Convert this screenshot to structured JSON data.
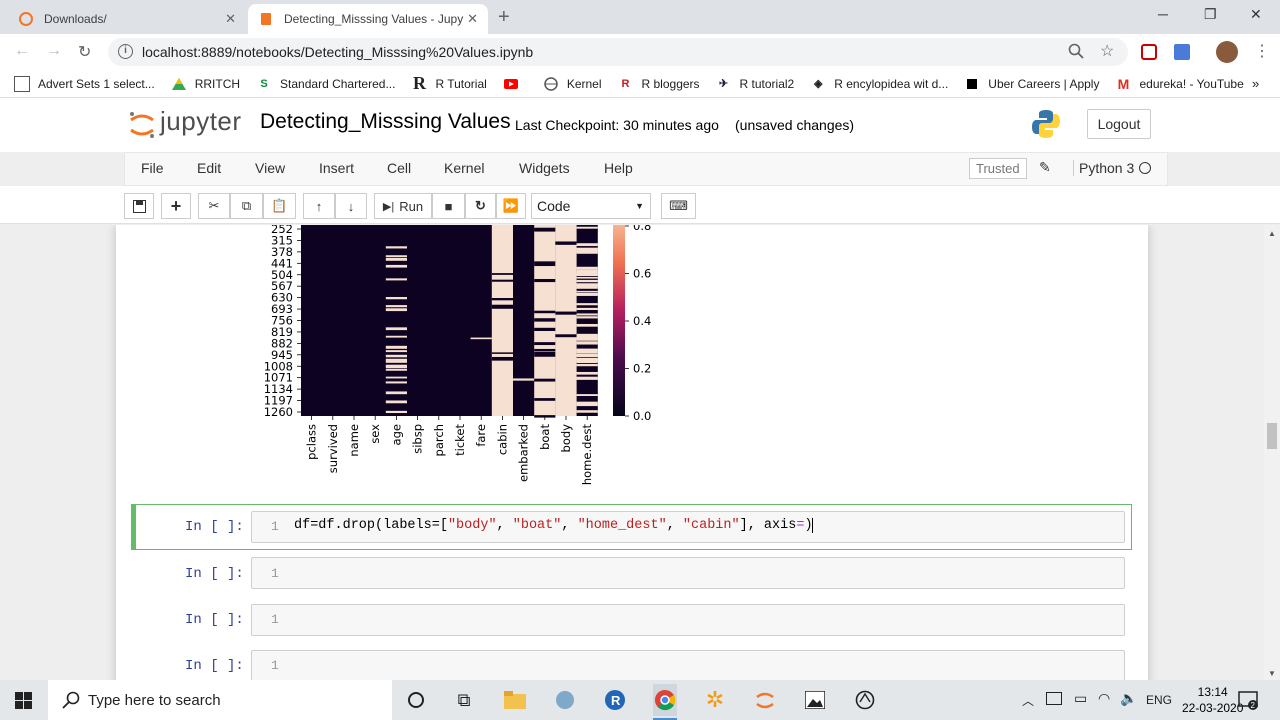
{
  "browser": {
    "tabs": [
      {
        "title": "Downloads/",
        "active": false
      },
      {
        "title": "Detecting_Misssing Values - Jupy",
        "active": true
      }
    ],
    "url": "localhost:8889/notebooks/Detecting_Misssing%20Values.ipynb",
    "bookmarks": [
      "Advert Sets 1 select...",
      "RRITCH",
      "Standard Chartered...",
      "R Tutorial",
      "",
      "Kernel",
      "R bloggers",
      "R tutorial2",
      "R encylopidea wit d...",
      "Uber Careers | Apply",
      "edureka! - YouTube"
    ]
  },
  "jupyter": {
    "logo": "jupyter",
    "title": "Detecting_Misssing Values",
    "checkpoint": "Last Checkpoint: 30 minutes ago",
    "unsaved": "(unsaved changes)",
    "logout": "Logout",
    "menu": [
      "File",
      "Edit",
      "View",
      "Insert",
      "Cell",
      "Kernel",
      "Widgets",
      "Help"
    ],
    "trusted": "Trusted",
    "kernel": "Python 3",
    "run_label": "Run",
    "cell_type": "Code"
  },
  "chart_data": {
    "type": "heatmap",
    "columns": [
      "pclass",
      "survived",
      "name",
      "sex",
      "age",
      "sibsp",
      "parch",
      "ticket",
      "fare",
      "cabin",
      "embarked",
      "boat",
      "body",
      "home.dest"
    ],
    "row_ticks": [
      "252",
      "315",
      "378",
      "441",
      "504",
      "567",
      "630",
      "693",
      "756",
      "819",
      "882",
      "945",
      "1008",
      "1071",
      "1134",
      "1197",
      "1260"
    ],
    "colorbar_ticks": [
      "0.0",
      "0.2",
      "0.4",
      "0.6",
      "0.8"
    ],
    "missing_fraction": {
      "pclass": 0,
      "survived": 0,
      "name": 0,
      "sex": 0,
      "age": 0.2,
      "sibsp": 0,
      "parch": 0,
      "ticket": 0,
      "fare": 0.001,
      "cabin": 0.77,
      "embarked": 0.002,
      "boat": 0.63,
      "body": 0.91,
      "home.dest": 0.43
    },
    "colors": {
      "present": "#0d0221",
      "missing": "#f6e0d2"
    }
  },
  "cells": [
    {
      "prompt": "In [ ]:",
      "line": "1",
      "code_parts": [
        "df=df.drop(labels=[",
        "\"body\"",
        ", ",
        "\"boat\"",
        ", ",
        "\"home_dest\"",
        ", ",
        "\"cabin\"",
        "], axis",
        "=",
        ")"
      ]
    },
    {
      "prompt": "In [ ]:",
      "line": "1"
    },
    {
      "prompt": "In [ ]:",
      "line": "1"
    },
    {
      "prompt": "In [ ]:",
      "line": "1"
    }
  ],
  "taskbar": {
    "search_placeholder": "Type here to search",
    "lang": "ENG",
    "time": "13:14",
    "date": "22-03-2020"
  }
}
